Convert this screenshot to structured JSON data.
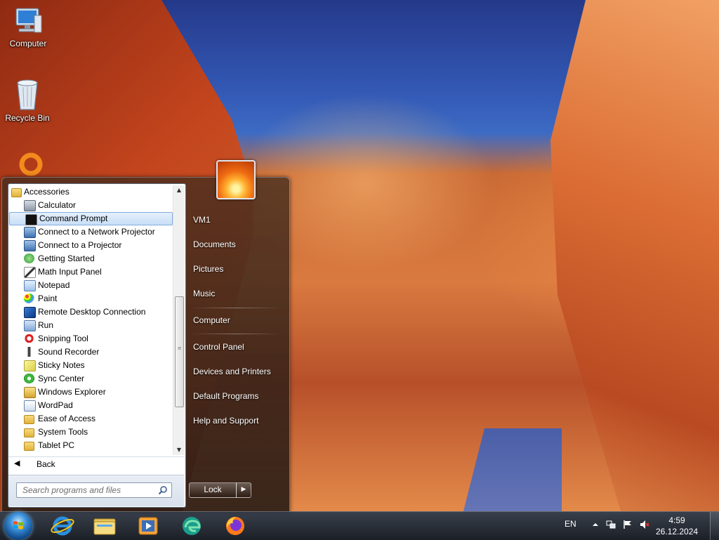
{
  "desktop": {
    "icons": [
      {
        "label": "Computer"
      },
      {
        "label": "Recycle Bin"
      }
    ]
  },
  "start_menu": {
    "programs": {
      "folder": "Accessories",
      "items": [
        {
          "label": "Calculator",
          "icon": "calculator-icon"
        },
        {
          "label": "Command Prompt",
          "icon": "command-prompt-icon",
          "selected": true
        },
        {
          "label": "Connect to a Network Projector",
          "icon": "network-projector-icon"
        },
        {
          "label": "Connect to a Projector",
          "icon": "projector-icon"
        },
        {
          "label": "Getting Started",
          "icon": "getting-started-icon"
        },
        {
          "label": "Math Input Panel",
          "icon": "math-input-icon"
        },
        {
          "label": "Notepad",
          "icon": "notepad-icon"
        },
        {
          "label": "Paint",
          "icon": "paint-icon"
        },
        {
          "label": "Remote Desktop Connection",
          "icon": "remote-desktop-icon"
        },
        {
          "label": "Run",
          "icon": "run-icon"
        },
        {
          "label": "Snipping Tool",
          "icon": "snipping-tool-icon"
        },
        {
          "label": "Sound Recorder",
          "icon": "microphone-icon"
        },
        {
          "label": "Sticky Notes",
          "icon": "sticky-notes-icon"
        },
        {
          "label": "Sync Center",
          "icon": "sync-center-icon"
        },
        {
          "label": "Windows Explorer",
          "icon": "windows-explorer-icon"
        },
        {
          "label": "WordPad",
          "icon": "wordpad-icon"
        },
        {
          "label": "Ease of Access",
          "icon": "folder-icon"
        },
        {
          "label": "System Tools",
          "icon": "folder-icon"
        },
        {
          "label": "Tablet PC",
          "icon": "folder-icon"
        }
      ]
    },
    "back_label": "Back",
    "search_placeholder": "Search programs and files",
    "right_pane": {
      "user": "VM1",
      "documents": "Documents",
      "pictures": "Pictures",
      "music": "Music",
      "computer": "Computer",
      "control_panel": "Control Panel",
      "devices": "Devices and Printers",
      "default_programs": "Default Programs",
      "help": "Help and Support"
    },
    "lock_label": "Lock"
  },
  "taskbar": {
    "language": "EN",
    "time": "4:59",
    "date": "26.12.2024"
  },
  "colors": {
    "selection": "#c8dff7",
    "selection_border": "#84acdd",
    "taskbar": "#1c222c"
  }
}
